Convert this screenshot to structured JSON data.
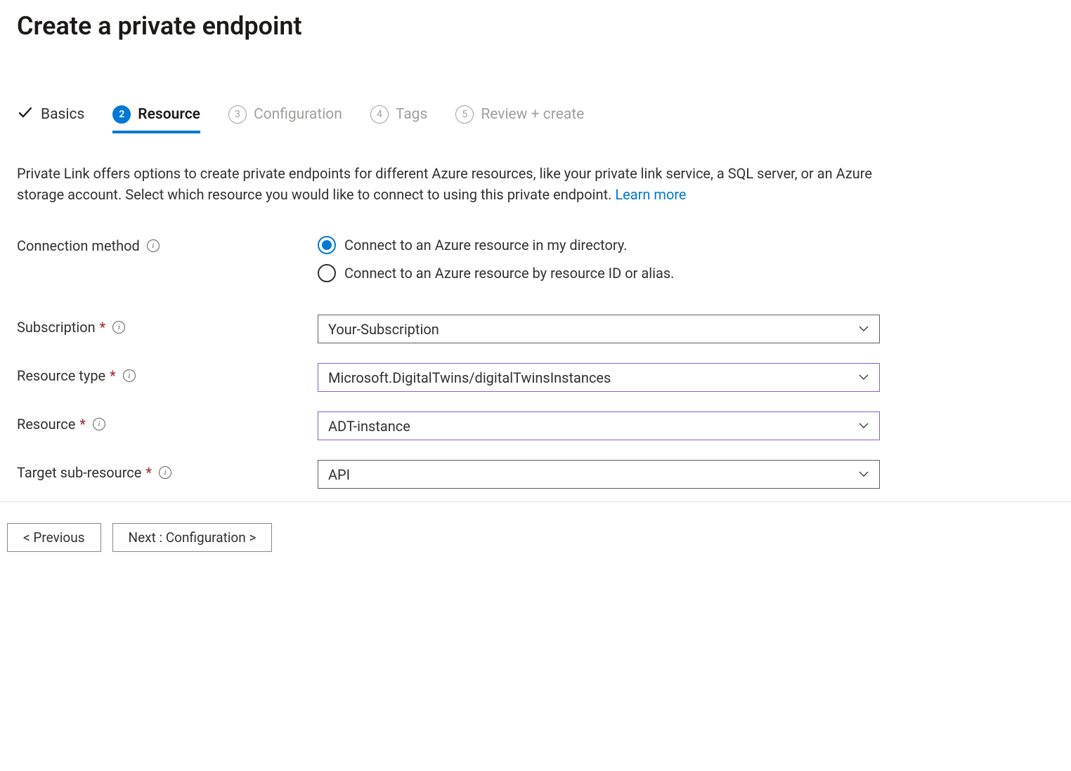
{
  "header": {
    "title": "Create a private endpoint"
  },
  "tabs": [
    {
      "label": "Basics",
      "status": "completed"
    },
    {
      "label": "Resource",
      "status": "active",
      "number": "2"
    },
    {
      "label": "Configuration",
      "status": "pending",
      "number": "3"
    },
    {
      "label": "Tags",
      "status": "pending",
      "number": "4"
    },
    {
      "label": "Review + create",
      "status": "pending",
      "number": "5"
    }
  ],
  "description": {
    "text": "Private Link offers options to create private endpoints for different Azure resources, like your private link service, a SQL server, or an Azure storage account. Select which resource you would like to connect to using this private endpoint.  ",
    "link_label": "Learn more"
  },
  "fields": {
    "connection_method": {
      "label": "Connection method",
      "options": [
        {
          "label": "Connect to an Azure resource in my directory.",
          "selected": true
        },
        {
          "label": "Connect to an Azure resource by resource ID or alias.",
          "selected": false
        }
      ]
    },
    "subscription": {
      "label": "Subscription",
      "value": "Your-Subscription"
    },
    "resource_type": {
      "label": "Resource type",
      "value": "Microsoft.DigitalTwins/digitalTwinsInstances"
    },
    "resource": {
      "label": "Resource",
      "value": "ADT-instance"
    },
    "target_sub_resource": {
      "label": "Target sub-resource",
      "value": "API"
    }
  },
  "footer": {
    "previous_label": "< Previous",
    "next_label": "Next : Configuration >"
  }
}
